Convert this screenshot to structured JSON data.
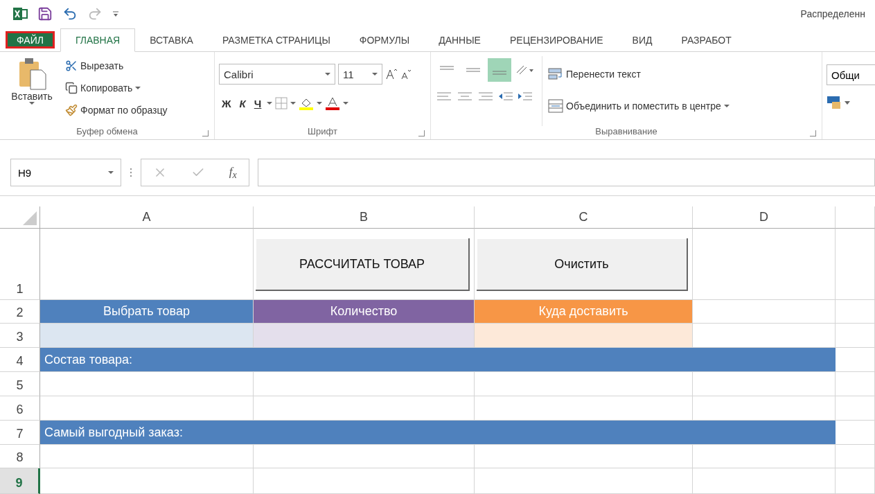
{
  "window": {
    "title": "Распределенн"
  },
  "tabs": [
    {
      "label": "ФАЙЛ",
      "kind": "file",
      "selected": false
    },
    {
      "label": "ГЛАВНАЯ",
      "kind": "tab",
      "selected": true
    },
    {
      "label": "ВСТАВКА",
      "kind": "tab",
      "selected": false
    },
    {
      "label": "РАЗМЕТКА СТРАНИЦЫ",
      "kind": "tab",
      "selected": false
    },
    {
      "label": "ФОРМУЛЫ",
      "kind": "tab",
      "selected": false
    },
    {
      "label": "ДАННЫЕ",
      "kind": "tab",
      "selected": false
    },
    {
      "label": "РЕЦЕНЗИРОВАНИЕ",
      "kind": "tab",
      "selected": false
    },
    {
      "label": "ВИД",
      "kind": "tab",
      "selected": false
    },
    {
      "label": "РАЗРАБОТ",
      "kind": "tab",
      "selected": false
    }
  ],
  "clipboard": {
    "paste": "Вставить",
    "cut": "Вырезать",
    "copy": "Копировать",
    "format_painter": "Формат по образцу",
    "label": "Буфер обмена"
  },
  "font": {
    "name": "Calibri",
    "size": "11",
    "bold": "Ж",
    "italic": "К",
    "underline": "Ч",
    "label": "Шрифт"
  },
  "alignment": {
    "vertical_align": [
      {
        "selected": false
      },
      {
        "selected": false
      },
      {
        "selected": true
      }
    ],
    "wrap_text": "Перенести текст",
    "merge": "Объединить и поместить в центре",
    "label": "Выравнивание"
  },
  "number": {
    "format": "Общи"
  },
  "formula_bar": {
    "name_box": "H9",
    "function_label": "f$_{x}$"
  },
  "columns": [
    {
      "label": "A"
    },
    {
      "label": "B"
    },
    {
      "label": "C"
    },
    {
      "label": "D"
    }
  ],
  "rows": [
    {
      "label": "1",
      "selected": false
    },
    {
      "label": "2",
      "selected": false
    },
    {
      "label": "3",
      "selected": false
    },
    {
      "label": "4",
      "selected": false
    },
    {
      "label": "5",
      "selected": false
    },
    {
      "label": "6",
      "selected": false
    },
    {
      "label": "7",
      "selected": false
    },
    {
      "label": "8",
      "selected": false
    },
    {
      "label": "9",
      "selected": true
    }
  ],
  "sheet_buttons": [
    {
      "label": "РАССЧИТАТЬ ТОВАР"
    },
    {
      "label": "Очистить"
    }
  ],
  "header_cells": [
    {
      "text": "Выбрать товар",
      "color": "#4f81bd"
    },
    {
      "text": "Количество",
      "color": "#8064a2"
    },
    {
      "text": "Куда доставить",
      "color": "#f79646"
    }
  ],
  "input_cells": [
    {
      "color": "#dce6f1"
    },
    {
      "color": "#e4dfec"
    },
    {
      "color": "#fde9d9"
    }
  ],
  "banners": [
    {
      "text": "Состав товара:"
    },
    {
      "text": "Самый выгодный заказ:"
    }
  ]
}
